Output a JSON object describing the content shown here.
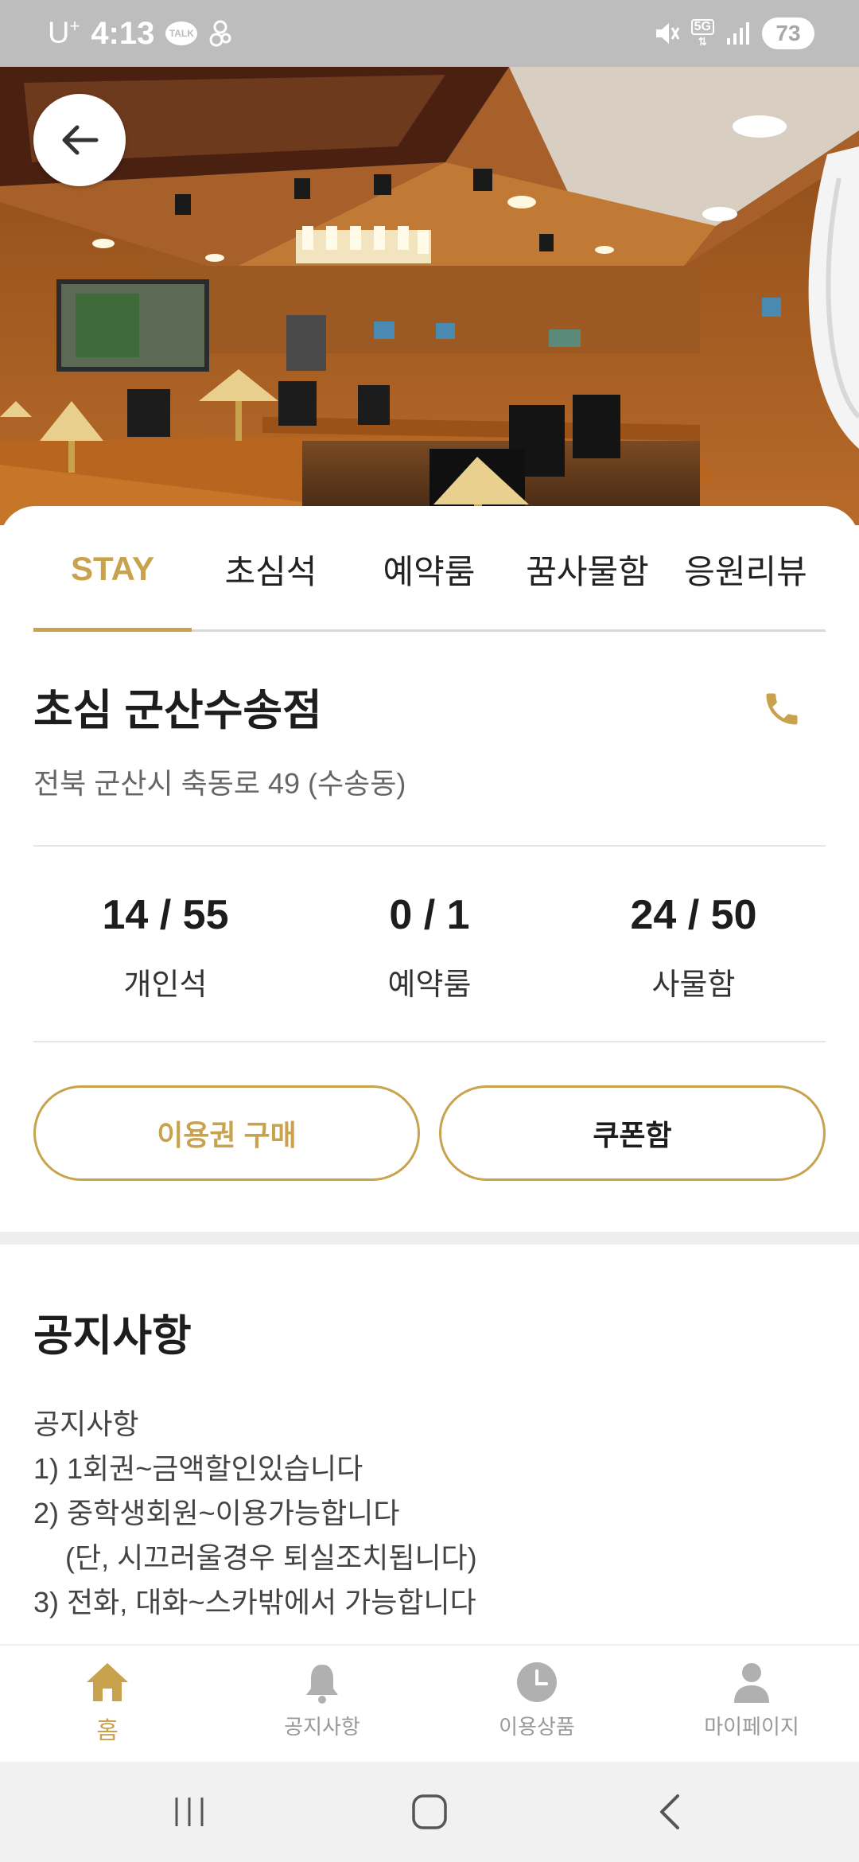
{
  "status_bar": {
    "carrier": "U",
    "carrier_sup": "+",
    "time": "4:13",
    "talk_badge": "TALK",
    "network": "5G",
    "battery": "73"
  },
  "tabs": [
    {
      "label": "STAY",
      "active": true
    },
    {
      "label": "초심석",
      "active": false
    },
    {
      "label": "예약룸",
      "active": false
    },
    {
      "label": "꿈사물함",
      "active": false
    },
    {
      "label": "응원리뷰",
      "active": false
    }
  ],
  "store": {
    "name": "초심 군산수송점",
    "address": "전북 군산시 축동로 49 (수송동)"
  },
  "stats": [
    {
      "value": "14 / 55",
      "label": "개인석"
    },
    {
      "value": "0 / 1",
      "label": "예약룸"
    },
    {
      "value": "24 / 50",
      "label": "사물함"
    }
  ],
  "buttons": {
    "purchase": "이용권 구매",
    "coupon": "쿠폰함"
  },
  "notice": {
    "title": "공지사항",
    "lines": [
      "공지사항",
      "1) 1회권~금액할인있습니다",
      "2) 중학생회원~이용가능합니다",
      "    (단, 시끄러울경우 퇴실조치됩니다)",
      "3) 전화, 대화~스카밖에서 가능합니다"
    ]
  },
  "bottom_nav": [
    {
      "label": "홈",
      "icon": "home-icon",
      "active": true
    },
    {
      "label": "공지사항",
      "icon": "bell-icon",
      "active": false
    },
    {
      "label": "이용상품",
      "icon": "clock-icon",
      "active": false
    },
    {
      "label": "마이페이지",
      "icon": "person-icon",
      "active": false
    }
  ],
  "colors": {
    "accent": "#c9a24e",
    "status_bar": "#bdbdbd",
    "inactive_nav": "#b0b0b0"
  }
}
